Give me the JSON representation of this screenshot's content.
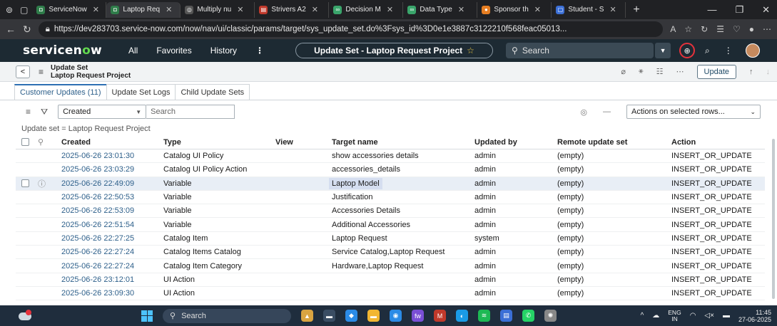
{
  "browser": {
    "tabs": [
      {
        "label": "ServiceNow",
        "fav_color": "#2f7d4a",
        "fav_glyph": "◘",
        "active": false
      },
      {
        "label": "Laptop Req",
        "fav_color": "#2f7d4a",
        "fav_glyph": "◘",
        "active": true
      },
      {
        "label": "Multiply nu",
        "fav_color": "#555555",
        "fav_glyph": "◎",
        "active": false
      },
      {
        "label": "Strivers A2",
        "fav_color": "#c0392b",
        "fav_glyph": "▤",
        "active": false
      },
      {
        "label": "Decision M",
        "fav_color": "#3aa56b",
        "fav_glyph": "∞",
        "active": false
      },
      {
        "label": "Data Type",
        "fav_color": "#3aa56b",
        "fav_glyph": "∞",
        "active": false
      },
      {
        "label": "Sponsor th",
        "fav_color": "#e67e22",
        "fav_glyph": "●",
        "active": false
      },
      {
        "label": "Student - S",
        "fav_color": "#3b6fd6",
        "fav_glyph": "▢",
        "active": false
      }
    ],
    "url": "https://dev283703.service-now.com/now/nav/ui/classic/params/target/sys_update_set.do%3Fsys_id%3D0e1e3887c3122210f568feac05013..."
  },
  "header": {
    "logo_a": "servicen",
    "logo_o": "o",
    "logo_b": "w",
    "nav_all": "All",
    "nav_favorites": "Favorites",
    "nav_history": "History",
    "nav_more": "⋮",
    "context_title": "Update Set - Laptop Request Project",
    "search_label": "Search"
  },
  "form": {
    "table_label": "Update Set",
    "record_name": "Laptop Request Project",
    "update_button": "Update"
  },
  "related_tabs": [
    "Customer Updates (11)",
    "Update Set Logs",
    "Child Update Sets"
  ],
  "list": {
    "filter_field": "Created",
    "search_placeholder": "Search",
    "actions_label": "Actions on selected rows...",
    "breadcrumb": "Update set = Laptop Request Project",
    "columns": [
      "Created",
      "Type",
      "View",
      "Target name",
      "Updated by",
      "Remote update set",
      "Action"
    ],
    "rows": [
      {
        "created": "2025-06-26 23:01:30",
        "type": "Catalog UI Policy",
        "view": "",
        "target": "show accessories details",
        "updated_by": "admin",
        "remote": "(empty)",
        "action": "INSERT_OR_UPDATE"
      },
      {
        "created": "2025-06-26 23:03:29",
        "type": "Catalog UI Policy Action",
        "view": "",
        "target": "accessories_details",
        "updated_by": "admin",
        "remote": "(empty)",
        "action": "INSERT_OR_UPDATE"
      },
      {
        "created": "2025-06-26 22:49:09",
        "type": "Variable",
        "view": "",
        "target": "Laptop Model",
        "updated_by": "admin",
        "remote": "(empty)",
        "action": "INSERT_OR_UPDATE"
      },
      {
        "created": "2025-06-26 22:50:53",
        "type": "Variable",
        "view": "",
        "target": "Justification",
        "updated_by": "admin",
        "remote": "(empty)",
        "action": "INSERT_OR_UPDATE"
      },
      {
        "created": "2025-06-26 22:53:09",
        "type": "Variable",
        "view": "",
        "target": "Accessories Details",
        "updated_by": "admin",
        "remote": "(empty)",
        "action": "INSERT_OR_UPDATE"
      },
      {
        "created": "2025-06-26 22:51:54",
        "type": "Variable",
        "view": "",
        "target": "Additional Accessories",
        "updated_by": "admin",
        "remote": "(empty)",
        "action": "INSERT_OR_UPDATE"
      },
      {
        "created": "2025-06-26 22:27:25",
        "type": "Catalog Item",
        "view": "",
        "target": "Laptop Request",
        "updated_by": "system",
        "remote": "(empty)",
        "action": "INSERT_OR_UPDATE"
      },
      {
        "created": "2025-06-26 22:27:24",
        "type": "Catalog Items Catalog",
        "view": "",
        "target": "Service Catalog,Laptop Request",
        "updated_by": "admin",
        "remote": "(empty)",
        "action": "INSERT_OR_UPDATE"
      },
      {
        "created": "2025-06-26 22:27:24",
        "type": "Catalog Item Category",
        "view": "",
        "target": "Hardware,Laptop Request",
        "updated_by": "admin",
        "remote": "(empty)",
        "action": "INSERT_OR_UPDATE"
      },
      {
        "created": "2025-06-26 23:12:01",
        "type": "UI Action",
        "view": "",
        "target": "",
        "updated_by": "admin",
        "remote": "(empty)",
        "action": "INSERT_OR_UPDATE"
      },
      {
        "created": "2025-06-26 23:09:30",
        "type": "UI Action",
        "view": "",
        "target": "",
        "updated_by": "admin",
        "remote": "(empty)",
        "action": "INSERT_OR_UPDATE"
      }
    ]
  },
  "taskbar": {
    "search_label": "Search",
    "lang_top": "ENG",
    "lang_bottom": "IN",
    "time": "11:45",
    "date": "27-06-2025",
    "apps": [
      {
        "color": "#d9a441",
        "glyph": "▲"
      },
      {
        "color": "#3a4d63",
        "glyph": "▬"
      },
      {
        "color": "#2b8be6",
        "glyph": "◆"
      },
      {
        "color": "#f2b632",
        "glyph": "▬"
      },
      {
        "color": "#2b8be6",
        "glyph": "◉"
      },
      {
        "color": "#7a4fd6",
        "glyph": "fw"
      },
      {
        "color": "#c0392b",
        "glyph": "M"
      },
      {
        "color": "#1a9be6",
        "glyph": "◐"
      },
      {
        "color": "#1db954",
        "glyph": "≋"
      },
      {
        "color": "#3b6fd6",
        "glyph": "▤"
      },
      {
        "color": "#25d366",
        "glyph": "✆"
      },
      {
        "color": "#888888",
        "glyph": "✺"
      }
    ]
  }
}
